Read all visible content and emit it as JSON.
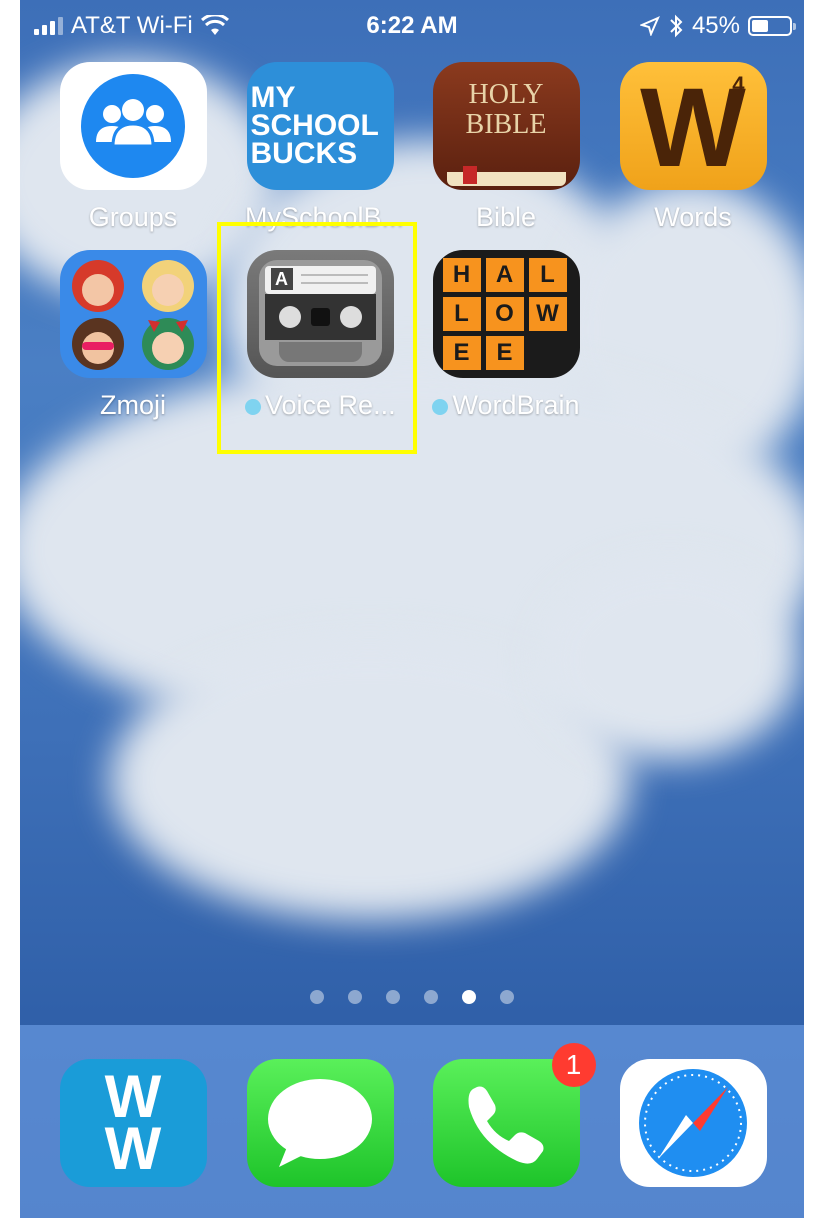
{
  "status_bar": {
    "carrier": "AT&T Wi-Fi",
    "time": "6:22 AM",
    "battery": "45%",
    "battery_level": 0.45,
    "icons": [
      "signal-icon",
      "wifi-icon",
      "location-icon",
      "bluetooth-icon",
      "battery-icon"
    ]
  },
  "apps": [
    {
      "label": "Groups",
      "icon": "groups-icon"
    },
    {
      "label": "MySchoolB...",
      "icon": "myschoolbucks-icon",
      "icon_text": [
        "MY",
        "SCHOOL",
        "BUCKS"
      ]
    },
    {
      "label": "Bible",
      "icon": "bible-icon",
      "icon_text": [
        "HOLY",
        "BIBLE"
      ]
    },
    {
      "label": "Words",
      "icon": "words-icon",
      "icon_text": "W",
      "badge": "4"
    },
    {
      "label": "Zmoji",
      "icon": "zmoji-icon"
    },
    {
      "label": "Voice Re...",
      "icon": "voice-recorder-icon",
      "icon_text": "A",
      "new_dot": true
    },
    {
      "label": "WordBrain",
      "icon": "wordbrain-icon",
      "tiles": [
        "H",
        "A",
        "L",
        "L",
        "O",
        "W",
        "E",
        "E"
      ],
      "new_dot": true
    }
  ],
  "page_indicator": {
    "count": 6,
    "active": 5
  },
  "dock": [
    {
      "name": "ww",
      "icon": "ww-icon",
      "icon_text": [
        "W",
        "W"
      ]
    },
    {
      "name": "messages",
      "icon": "messages-icon"
    },
    {
      "name": "phone",
      "icon": "phone-icon",
      "badge": "1"
    },
    {
      "name": "safari",
      "icon": "safari-icon"
    }
  ],
  "colors": {
    "highlight": "#ffff00",
    "badge": "#ff3b30",
    "new_dot": "#7fd3f0"
  }
}
